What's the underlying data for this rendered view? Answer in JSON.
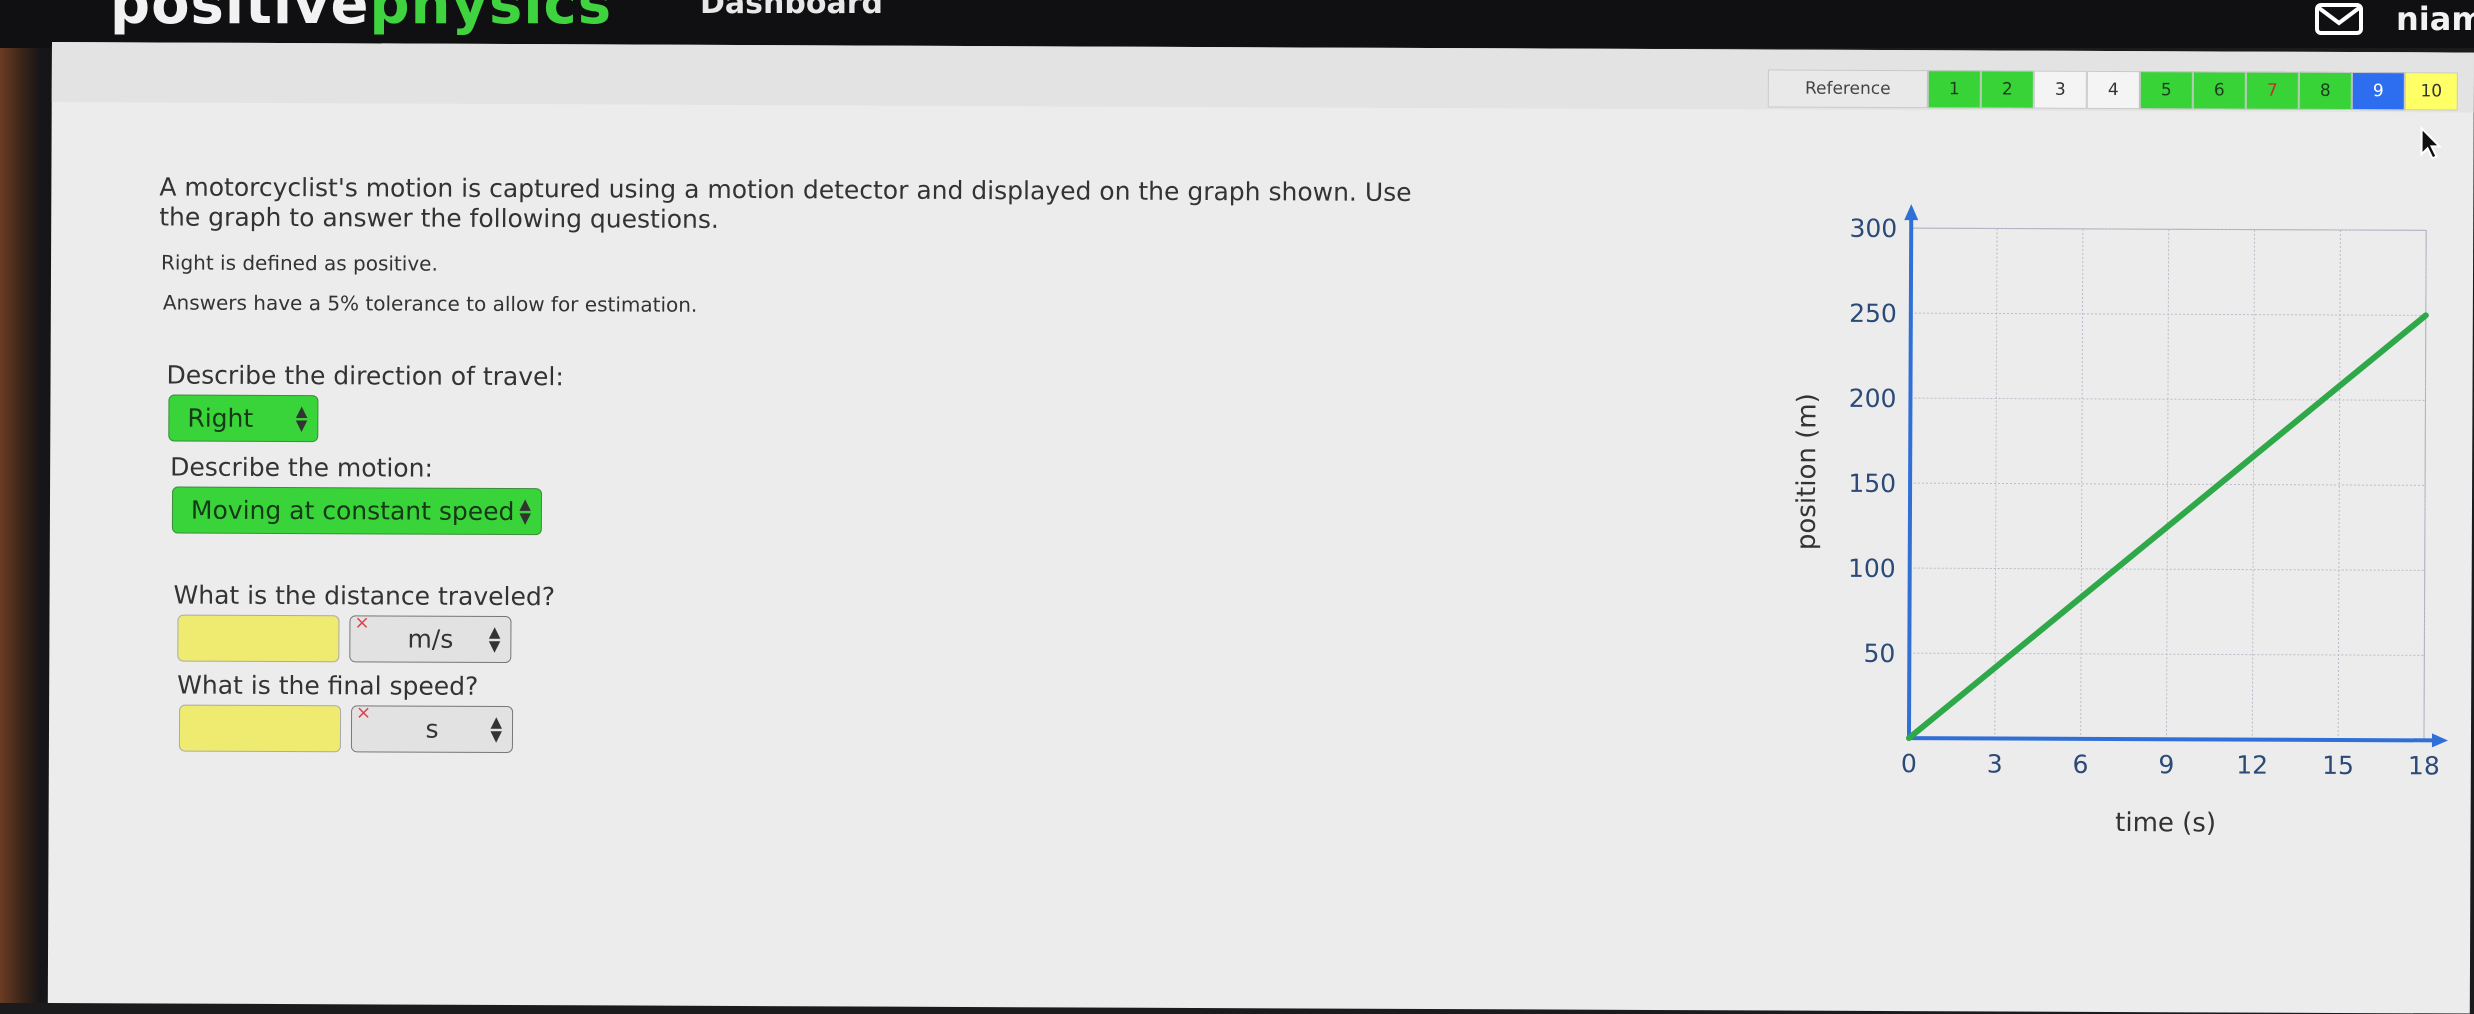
{
  "header": {
    "logo_main": "positive",
    "logo_accent": "physics",
    "nav_dashboard": "Dashboard",
    "user_name": "niamh"
  },
  "tabs": [
    {
      "label": "Reference",
      "state": "reference"
    },
    {
      "label": "1",
      "state": "correct"
    },
    {
      "label": "2",
      "state": "correct"
    },
    {
      "label": "3",
      "state": "unanswered"
    },
    {
      "label": "4",
      "state": "unanswered"
    },
    {
      "label": "5",
      "state": "correct"
    },
    {
      "label": "6",
      "state": "correct"
    },
    {
      "label": "7",
      "state": "incorrect"
    },
    {
      "label": "8",
      "state": "correct"
    },
    {
      "label": "9",
      "state": "current"
    },
    {
      "label": "10",
      "state": "partial"
    }
  ],
  "question": {
    "text": "A motorcyclist's motion is captured using a motion detector and displayed on the graph shown. Use the graph to answer the following questions.",
    "note1": "Right is defined as positive.",
    "note2": "Answers have a 5% tolerance to allow for estimation."
  },
  "answers": {
    "direction_label": "Describe the direction of travel:",
    "direction_value": "Right",
    "motion_label": "Describe the motion:",
    "motion_value": "Moving at constant speed",
    "distance_label": "What is the distance traveled?",
    "distance_value": "",
    "distance_unit": "m/s",
    "speed_label": "What is the final speed?",
    "speed_value": "",
    "speed_unit": "s"
  },
  "colors": {
    "correct": "#37d337",
    "current": "#2d6ef0",
    "partial": "#ffff66",
    "incorrect_text": "#b8352c",
    "axis": "#2f6fd6",
    "line": "#2fa84a",
    "input_empty": "#eeeb70"
  },
  "chart_data": {
    "type": "line",
    "xlabel": "time (s)",
    "ylabel": "position (m)",
    "xlim": [
      0,
      18
    ],
    "ylim": [
      0,
      300
    ],
    "xticks": [
      0,
      3,
      6,
      9,
      12,
      15,
      18
    ],
    "yticks": [
      50,
      100,
      150,
      200,
      250,
      300
    ],
    "grid": true,
    "series": [
      {
        "x": [
          0,
          18
        ],
        "y": [
          0,
          250
        ]
      }
    ]
  }
}
